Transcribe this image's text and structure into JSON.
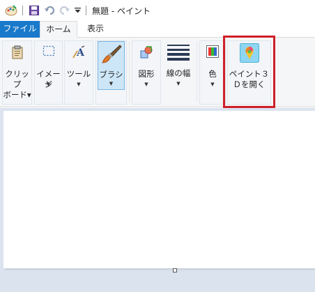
{
  "titlebar": {
    "title": "無題 - ペイント"
  },
  "tabs": {
    "file": "ファイル",
    "home": "ホーム",
    "view": "表示"
  },
  "ribbon": {
    "clipboard": {
      "line1": "クリップ",
      "line2": "ボード▾"
    },
    "image": {
      "label": "イメージ"
    },
    "tools": {
      "label": "ツール"
    },
    "brushes": {
      "label": "ブラシ"
    },
    "shapes": {
      "label": "図形"
    },
    "size": {
      "label": "線の幅"
    },
    "colors": {
      "label": "色"
    },
    "paint3d": {
      "line1": "ペイント３",
      "line2": "Ｄを開く"
    }
  },
  "colors": {
    "file_tab": "#1979ca",
    "highlight": "#d01f2a",
    "workspace": "#dbe3ef"
  }
}
